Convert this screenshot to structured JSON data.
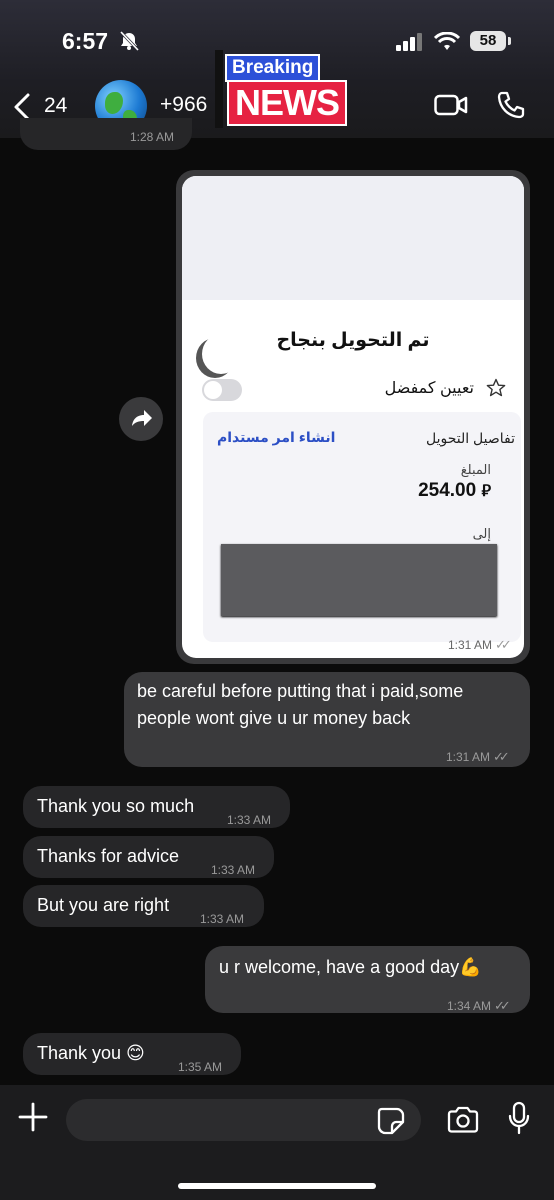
{
  "status": {
    "time": "6:57",
    "battery": "58"
  },
  "header": {
    "back_count": "24",
    "contact": "+966",
    "overlay_top": "Breaking",
    "overlay_bottom": "NEWS"
  },
  "previous": {
    "time": "1:28 AM"
  },
  "image_message": {
    "title": "تم التحويل بنجاح",
    "favorite_label": "تعيين كمفضل",
    "details_label": "تفاصيل التحويل",
    "reuse_label": "انشاء امر مستدام",
    "amount_label": "المبلغ",
    "amount": "254.00",
    "currency": "⃁",
    "to_label": "إلى",
    "time": "1:31 AM"
  },
  "messages": [
    {
      "direction": "out",
      "text": "be careful before putting that i paid,some people wont give u ur money back",
      "time": "1:31 AM"
    },
    {
      "direction": "in",
      "text": "Thank you so much",
      "time": "1:33 AM"
    },
    {
      "direction": "in",
      "text": "Thanks for advice",
      "time": "1:33 AM"
    },
    {
      "direction": "in",
      "text": "But you are right",
      "time": "1:33 AM"
    },
    {
      "direction": "out",
      "text": "u r welcome, have a good day💪",
      "time": "1:34 AM"
    },
    {
      "direction": "in",
      "text": "Thank you 😊",
      "time": "1:35 AM"
    }
  ],
  "composer": {
    "placeholder": ""
  },
  "icons": [
    "bell-slash-icon",
    "signal-icon",
    "wifi-icon",
    "chevron-left-icon",
    "video-call-icon",
    "phone-icon",
    "share-icon",
    "plus-icon",
    "sticker-icon",
    "camera-icon",
    "mic-icon",
    "star-icon"
  ]
}
